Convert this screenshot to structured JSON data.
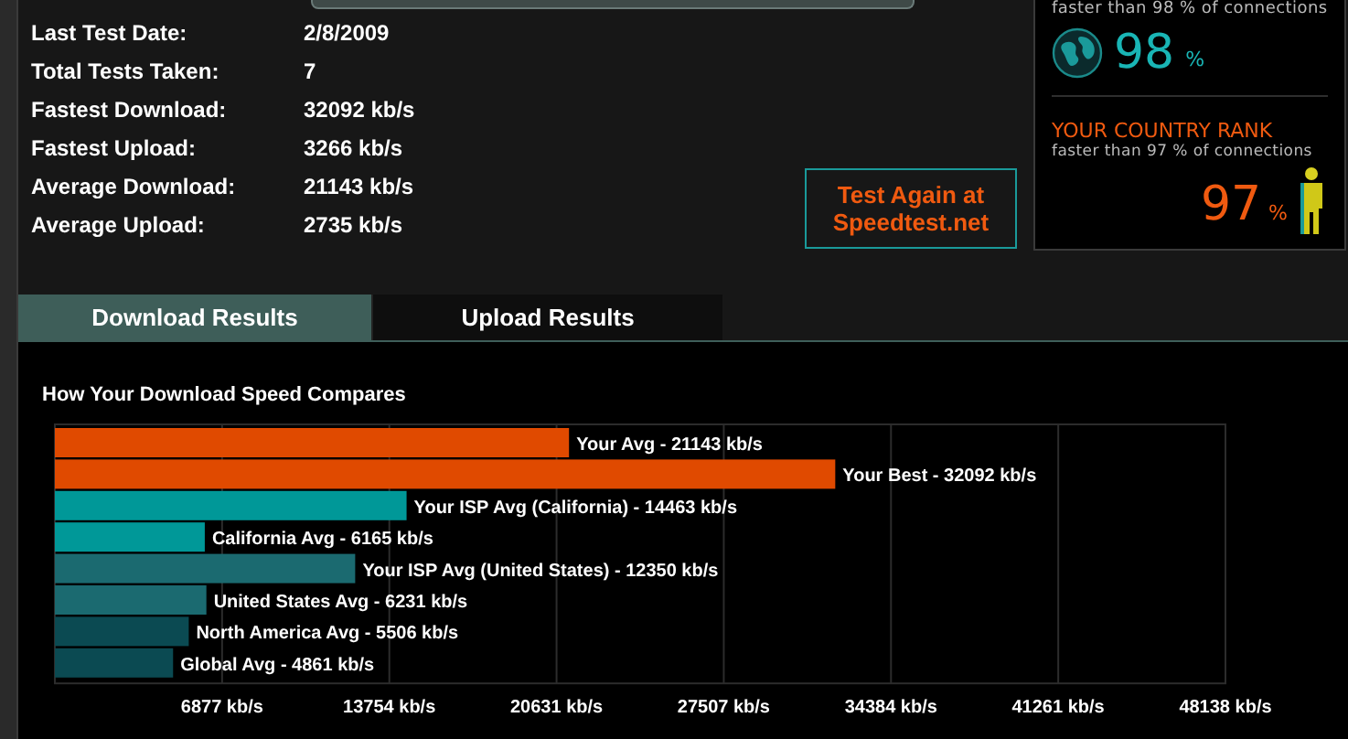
{
  "stats": [
    {
      "label": "Last Test Date:",
      "value": "2/8/2009"
    },
    {
      "label": "Total Tests Taken:",
      "value": "7"
    },
    {
      "label": "Fastest Download:",
      "value": "32092 kb/s"
    },
    {
      "label": "Fastest Upload:",
      "value": "3266 kb/s"
    },
    {
      "label": "Average Download:",
      "value": "21143 kb/s"
    },
    {
      "label": "Average Upload:",
      "value": "2735 kb/s"
    }
  ],
  "test_again_button": "Test Again at Speedtest.net",
  "rank_panel": {
    "world": {
      "caption": "faster than 98 % of connections",
      "value": "98",
      "unit": "%"
    },
    "country": {
      "title": "YOUR COUNTRY RANK",
      "caption": "faster than 97 % of connections",
      "value": "97",
      "unit": "%"
    }
  },
  "tabs": [
    {
      "label": "Download Results",
      "selected": true
    },
    {
      "label": "Upload Results",
      "selected": false
    }
  ],
  "chart_data": {
    "type": "bar",
    "orientation": "horizontal",
    "title": "How Your Download Speed Compares",
    "xlim": [
      0,
      48138
    ],
    "xticks": [
      {
        "value": 6877,
        "label": "6877 kb/s"
      },
      {
        "value": 13754,
        "label": "13754 kb/s"
      },
      {
        "value": 20631,
        "label": "20631 kb/s"
      },
      {
        "value": 27507,
        "label": "27507 kb/s"
      },
      {
        "value": 34384,
        "label": "34384 kb/s"
      },
      {
        "value": 41261,
        "label": "41261 kb/s"
      },
      {
        "value": 48138,
        "label": "48138 kb/s"
      }
    ],
    "values": [
      21143,
      32092,
      14463,
      6165,
      12350,
      6231,
      5506,
      4861
    ],
    "colors": [
      "#e04a00",
      "#e04a00",
      "#009898",
      "#009898",
      "#1b6a70",
      "#1b6a70",
      "#0b4a52",
      "#0b4a52"
    ],
    "grid": true,
    "categories": [
      "Your Avg - 21143 kb/s",
      "Your Best - 32092 kb/s",
      "Your ISP Avg (California) - 14463 kb/s",
      "California Avg - 6165 kb/s",
      "Your ISP Avg (United States) - 12350 kb/s",
      "United States Avg - 6231 kb/s",
      "North America Avg - 5506 kb/s",
      "Global Avg - 4861 kb/s"
    ]
  }
}
